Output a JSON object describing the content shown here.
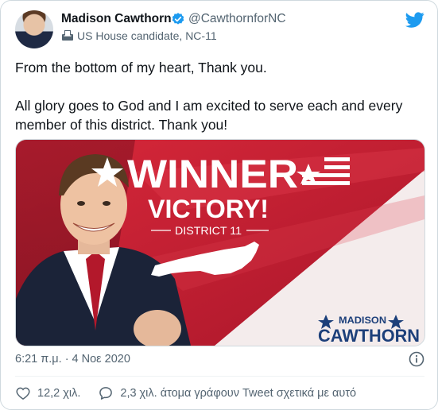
{
  "tweet": {
    "author_name": "Madison Cawthorn",
    "handle": "@CawthornforNC",
    "label": "US House candidate, NC-11",
    "paragraphs": [
      "From the bottom of my heart, Thank you.",
      "All glory goes to God and I am excited to serve each and every member of this district. Thank you!"
    ],
    "timestamp": "6:21 π.μ. · 4 Νοε 2020",
    "likes": "12,2 χιλ.",
    "discussion": "2,3 χιλ. άτομα γράφουν Tweet σχετικά με αυτό"
  },
  "image": {
    "headline": "WINNER",
    "subhead": "VICTORY!",
    "district": "DISTRICT 11",
    "brand_top": "MADISON",
    "brand_bottom": "CAWTHORN"
  },
  "colors": {
    "twitter_blue": "#1d9bf0",
    "banner_red": "#c41e2f",
    "brand_navy": "#1c3f7a",
    "text_secondary": "#536471"
  },
  "icons": {
    "verified": "verified-badge-icon",
    "label": "ballot-box-icon",
    "brand": "twitter-bird-icon",
    "info": "info-icon",
    "like": "heart-icon",
    "reply": "speech-bubble-icon",
    "brand_star": "star-icon",
    "flag": "flag-icon"
  }
}
